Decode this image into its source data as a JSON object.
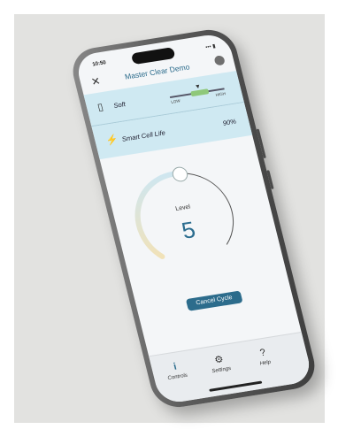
{
  "status_bar": {
    "time": "10:50",
    "indicators": "••• ▮"
  },
  "header": {
    "title": "Master Clear Demo",
    "close_icon": "close-icon",
    "avatar_icon": "user-icon"
  },
  "soft_row": {
    "label": "Soft",
    "icon": "bottle-icon",
    "scale_low": "LOW",
    "scale_high": "HIGH",
    "level_fraction": 0.55
  },
  "cell_row": {
    "label": "Smart Cell Life",
    "value": "90%",
    "icon": "lightning-icon"
  },
  "dial": {
    "caption": "Level",
    "value": "5",
    "progress_fraction": 0.6
  },
  "cancel_button": {
    "label": "Cancel Cycle"
  },
  "nav": {
    "items": [
      {
        "label": "Controls",
        "icon": "info-icon"
      },
      {
        "label": "Settings",
        "icon": "gear-icon"
      },
      {
        "label": "Help",
        "icon": "help-icon"
      }
    ]
  },
  "colors": {
    "accent": "#2c6c8c",
    "panel": "#cfe9f2",
    "dial_track": "#cfe6ef",
    "dial_warm": "#f1e2b8",
    "background": "#e2e2e0"
  }
}
